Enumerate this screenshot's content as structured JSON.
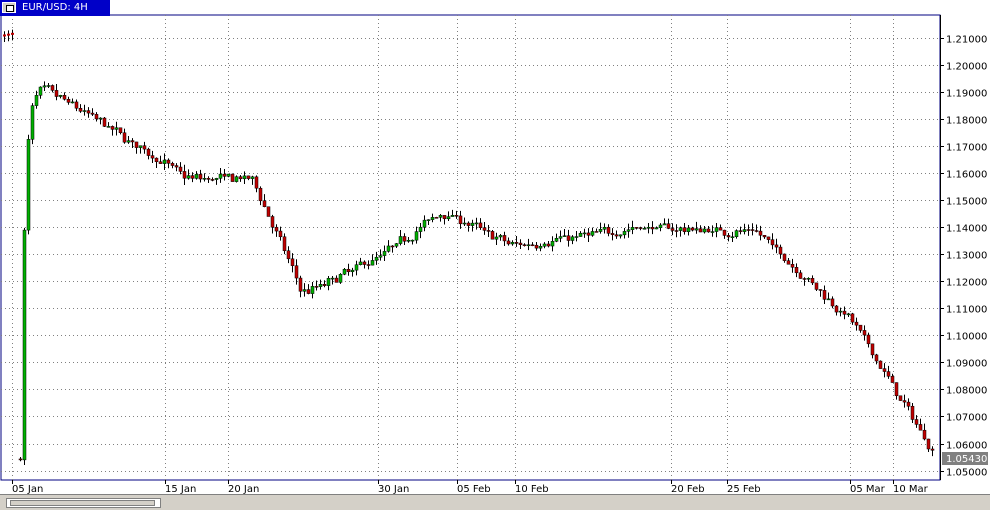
{
  "window": {
    "title": "EUR/USD: 4H"
  },
  "chart_data": {
    "type": "candlestick",
    "symbol": "EUR/USD",
    "timeframe": "4H",
    "y_ticks": [
      "1.21000",
      "1.20000",
      "1.19000",
      "1.18000",
      "1.17000",
      "1.16000",
      "1.15000",
      "1.14000",
      "1.13000",
      "1.12000",
      "1.11000",
      "1.10000",
      "1.09000",
      "1.08000",
      "1.07000",
      "1.06000",
      "1.05000"
    ],
    "x_ticks": [
      "05 Jan",
      "15 Jan",
      "20 Jan",
      "30 Jan",
      "05 Feb",
      "10 Feb",
      "20 Feb",
      "25 Feb",
      "05 Mar",
      "10 Mar"
    ],
    "ylim": [
      1.0465,
      1.2185
    ],
    "current_price": "1.05430",
    "grid": true,
    "up_color": "#00b000",
    "down_color": "#c00000",
    "price_path": [
      {
        "date": "05 Jan",
        "close": 1.195
      },
      {
        "date": "10 Jan",
        "close": 1.181
      },
      {
        "date": "15 Jan",
        "close": 1.158
      },
      {
        "date": "20 Jan",
        "close": 1.158
      },
      {
        "date": "26 Jan",
        "close": 1.115
      },
      {
        "date": "30 Jan",
        "close": 1.13
      },
      {
        "date": "05 Feb",
        "close": 1.146
      },
      {
        "date": "10 Feb",
        "close": 1.133
      },
      {
        "date": "20 Feb",
        "close": 1.14
      },
      {
        "date": "25 Feb",
        "close": 1.138
      },
      {
        "date": "05 Mar",
        "close": 1.105
      },
      {
        "date": "10 Mar",
        "close": 1.069
      },
      {
        "date": "13 Mar",
        "close": 1.0543
      }
    ]
  }
}
